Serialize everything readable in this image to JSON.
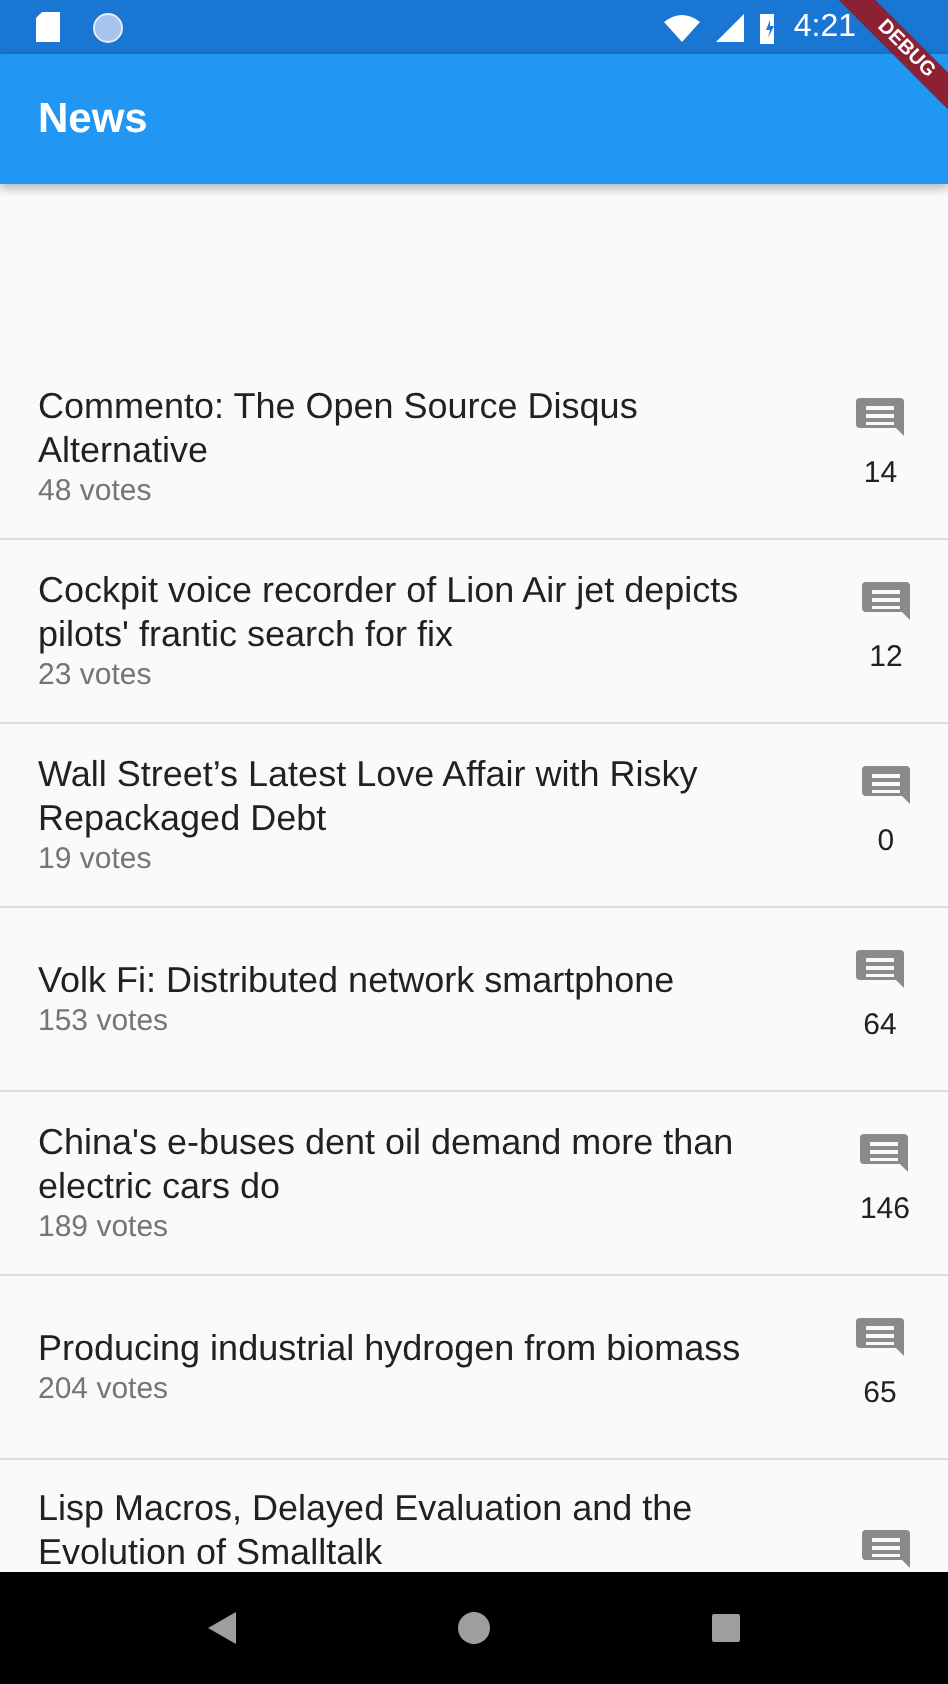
{
  "status_bar": {
    "time": "4:21"
  },
  "debug_banner": "DEBUG",
  "app_bar": {
    "title": "News"
  },
  "articles": [
    {
      "title": "Commento: The Open Source Disqus Alternative",
      "votes": "48 votes",
      "comments": "14"
    },
    {
      "title": "Cockpit voice recorder of Lion Air jet depicts pilots' frantic search for fix",
      "votes": "23 votes",
      "comments": "12"
    },
    {
      "title": "Wall Street’s Latest Love Affair with Risky Repackaged Debt",
      "votes": "19 votes",
      "comments": "0"
    },
    {
      "title": "Volk Fi: Distributed network smartphone",
      "votes": "153 votes",
      "comments": "64"
    },
    {
      "title": "China's e-buses dent oil demand more than electric cars do",
      "votes": "189 votes",
      "comments": "146"
    },
    {
      "title": "Producing industrial hydrogen from biomass",
      "votes": "204 votes",
      "comments": "65"
    },
    {
      "title": "Lisp Macros, Delayed Evaluation and the Evolution of Smalltalk"
    }
  ]
}
